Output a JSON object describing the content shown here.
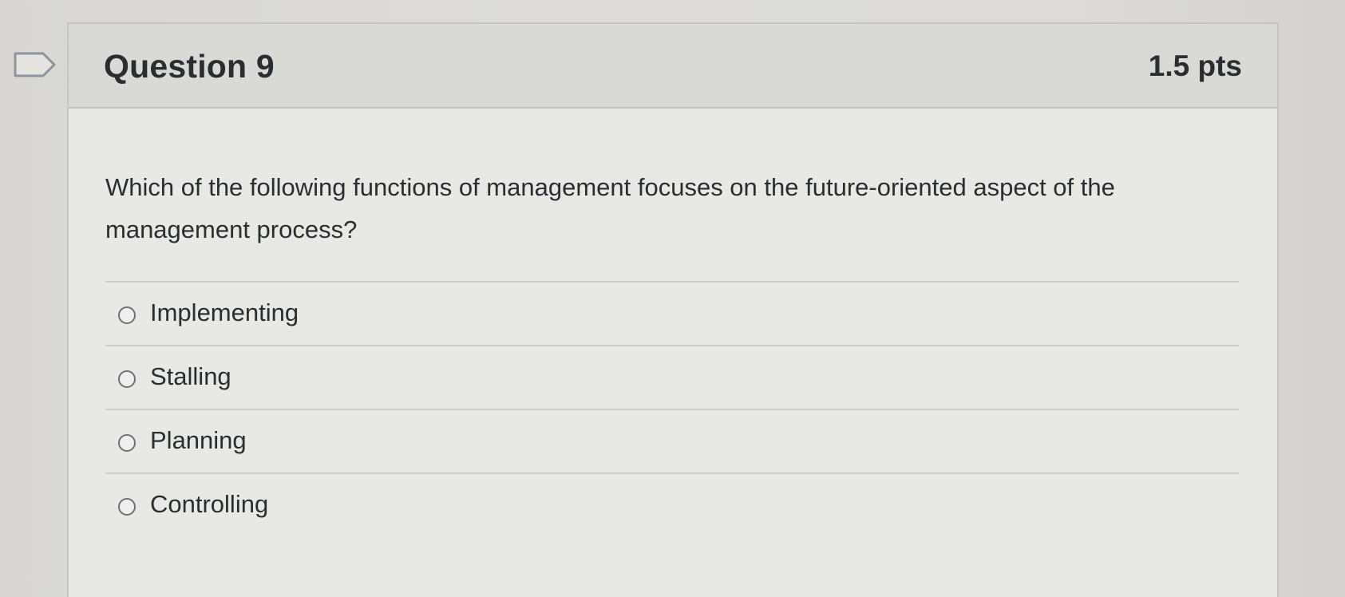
{
  "question": {
    "title": "Question 9",
    "points": "1.5 pts",
    "text": "Which of the following functions of management focuses on the future-oriented aspect of the management process?",
    "flag_icon": "flag-icon"
  },
  "answers": [
    {
      "label": "Implementing",
      "selected": false
    },
    {
      "label": "Stalling",
      "selected": false
    },
    {
      "label": "Planning",
      "selected": false
    },
    {
      "label": "Controlling",
      "selected": false
    }
  ],
  "colors": {
    "background": "#dcdbd7",
    "header": "#d9d9d6",
    "card": "#e8e8e5",
    "text": "#2a2e31"
  }
}
